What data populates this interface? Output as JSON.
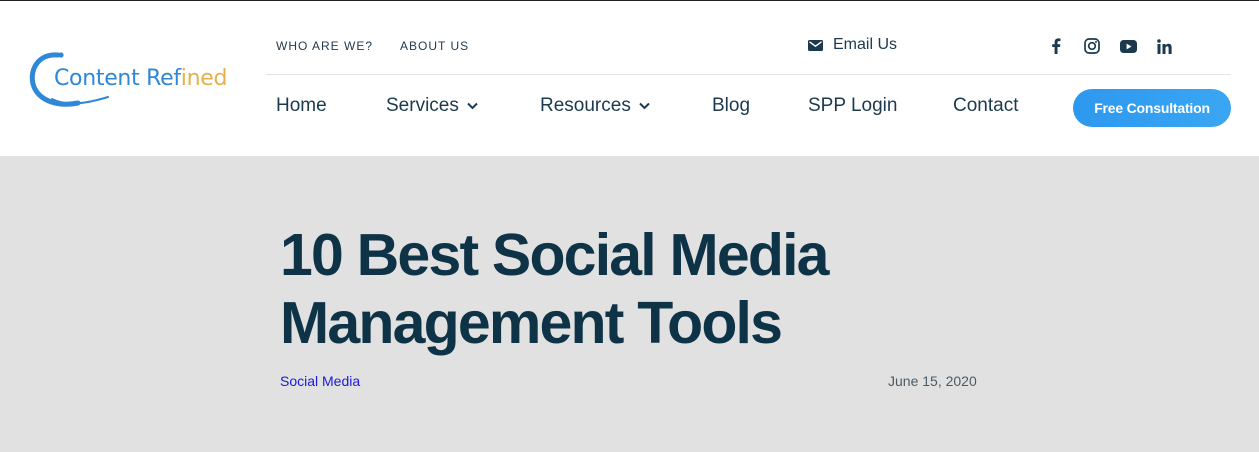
{
  "brand": {
    "name_part1": "Content ",
    "name_part2": "Ref",
    "name_part3": "ined",
    "colors": {
      "blue": "#2f87d8",
      "gold": "#e8b04a"
    }
  },
  "top_nav": [
    {
      "label": "WHO ARE WE?"
    },
    {
      "label": "ABOUT US"
    }
  ],
  "contact": {
    "icon": "envelope-icon",
    "label": "Email Us"
  },
  "social": [
    {
      "icon": "facebook-icon"
    },
    {
      "icon": "instagram-icon"
    },
    {
      "icon": "youtube-icon"
    },
    {
      "icon": "linkedin-icon"
    }
  ],
  "main_nav": [
    {
      "label": "Home"
    },
    {
      "label": "Services",
      "dropdown": true
    },
    {
      "label": "Resources",
      "dropdown": true
    },
    {
      "label": "Blog"
    },
    {
      "label": "SPP Login"
    },
    {
      "label": "Contact"
    }
  ],
  "cta": {
    "label": "Free Consultation",
    "color": "#2d98ef"
  },
  "article": {
    "title_line1": "10 Best Social Media",
    "title_line2": "Management Tools",
    "category": "Social Media",
    "date": "June 15, 2020"
  },
  "colors": {
    "header_bg": "#ffffff",
    "hero_bg": "#e1e1e1",
    "heading": "#0f3346",
    "nav_text": "#1b3a4e",
    "link": "#1a1ad8"
  }
}
